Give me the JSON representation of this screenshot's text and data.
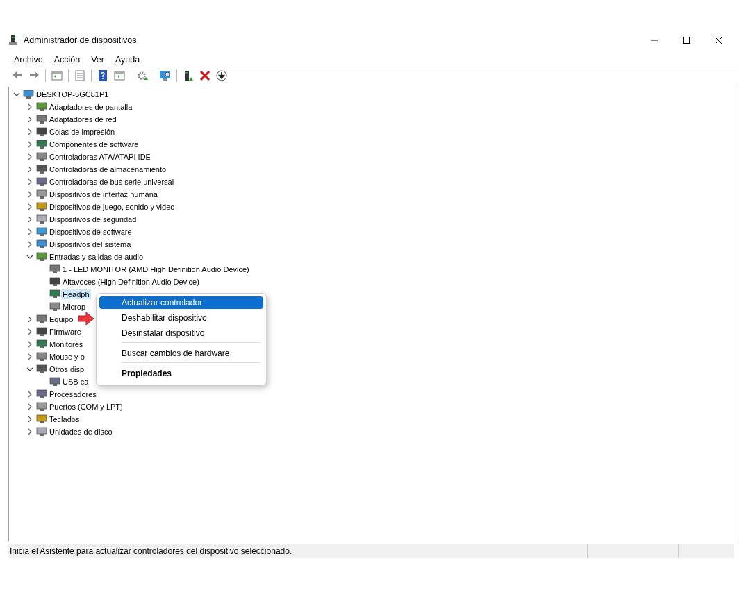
{
  "window": {
    "title": "Administrador de dispositivos"
  },
  "menu_bar": [
    "Archivo",
    "Acción",
    "Ver",
    "Ayuda"
  ],
  "tree": {
    "label": "DESKTOP-5GC81P1",
    "expanded": true,
    "selected": false,
    "children": [
      {
        "label": "Adaptadores de pantalla",
        "expanded": false,
        "selected": false
      },
      {
        "label": "Adaptadores de red",
        "expanded": false,
        "selected": false
      },
      {
        "label": "Colas de impresión",
        "expanded": false,
        "selected": false
      },
      {
        "label": "Componentes de software",
        "expanded": false,
        "selected": false
      },
      {
        "label": "Controladoras ATA/ATAPI IDE",
        "expanded": false,
        "selected": false
      },
      {
        "label": "Controladoras de almacenamiento",
        "expanded": false,
        "selected": false
      },
      {
        "label": "Controladoras de bus serie universal",
        "expanded": false,
        "selected": false
      },
      {
        "label": "Dispositivos de interfaz humana",
        "expanded": false,
        "selected": false
      },
      {
        "label": "Dispositivos de juego, sonido y video",
        "expanded": false,
        "selected": false
      },
      {
        "label": "Dispositivos de seguridad",
        "expanded": false,
        "selected": false
      },
      {
        "label": "Dispositivos de software",
        "expanded": false,
        "selected": false
      },
      {
        "label": "Dispositivos del sistema",
        "expanded": false,
        "selected": false
      },
      {
        "label": "Entradas y salidas de audio",
        "expanded": true,
        "selected": false,
        "children": [
          {
            "label": "1 - LED MONITOR (AMD High Definition Audio Device)",
            "selected": false
          },
          {
            "label": "Altavoces (High Definition Audio Device)",
            "selected": false
          },
          {
            "label": "Headph",
            "selected": true
          },
          {
            "label": "Microp",
            "selected": false
          }
        ]
      },
      {
        "label": "Equipo",
        "expanded": false,
        "selected": false
      },
      {
        "label": "Firmware",
        "expanded": false,
        "selected": false
      },
      {
        "label": "Monitores",
        "expanded": false,
        "selected": false
      },
      {
        "label": "Mouse y o",
        "expanded": false,
        "selected": false
      },
      {
        "label": "Otros disp",
        "expanded": true,
        "selected": false,
        "children": [
          {
            "label": "USB ca",
            "selected": false
          }
        ]
      },
      {
        "label": "Procesadores",
        "expanded": false,
        "selected": false
      },
      {
        "label": "Puertos (COM y LPT)",
        "expanded": false,
        "selected": false
      },
      {
        "label": "Teclados",
        "expanded": false,
        "selected": false
      },
      {
        "label": "Unidades de disco",
        "expanded": false,
        "selected": false
      }
    ]
  },
  "context_menu": [
    {
      "kind": "item",
      "label": "Actualizar controlador",
      "selected": true
    },
    {
      "kind": "item",
      "label": "Deshabilitar dispositivo",
      "selected": false
    },
    {
      "kind": "item",
      "label": "Desinstalar dispositivo",
      "selected": false
    },
    {
      "kind": "separator"
    },
    {
      "kind": "item",
      "label": "Buscar cambios de hardware",
      "selected": false
    },
    {
      "kind": "separator"
    },
    {
      "kind": "default",
      "label": "Propiedades",
      "selected": false
    }
  ],
  "status_bar": {
    "text": "Inicia el Asistente para actualizar controladores del dispositivo seleccionado."
  }
}
